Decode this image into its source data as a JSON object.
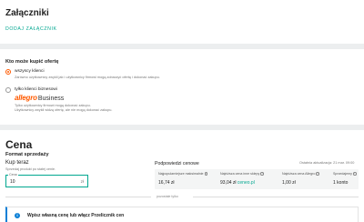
{
  "attachments": {
    "title": "Załączniki",
    "add_link": "DODAJ ZAŁĄCZNIK"
  },
  "buyers": {
    "title": "Kto może kupić ofertę",
    "options": [
      {
        "label": "wszyscy klienci",
        "desc": "Zarówno użytkownicy zwykli jak i użytkownicy firmowi mogą zobaczyć ofertę i dokonać zakupu.",
        "checked": true
      },
      {
        "label": "tylko klienci biznesowi",
        "desc_1": "Tylko użytkownicy firmowi mogą dokonać zakupu.",
        "desc_2": "Użytkownicy zwykli widzą ofertę, ale nie mogą dokonać zakupu.",
        "checked": false
      }
    ],
    "logo_word": "allegro",
    "logo_suffix": "Business"
  },
  "price": {
    "title": "Cena",
    "format_title": "Format sprzedaży",
    "buy_now": "Kup teraz",
    "buy_now_desc": "Sprzedaj produkt po stałej cenie.",
    "field_label": "Cena",
    "field_value": "10",
    "field_unit": "zł",
    "suggestions_title": "Podpowiedzi cenowe",
    "updated": "Ostatnia aktualizacja: 21 mar. 09:00",
    "columns": [
      {
        "header": "Najpopularniejsze maksimalnie",
        "value": "16,74 zł"
      },
      {
        "header": "Najniższa cena inne sklepy",
        "value": "93,04 zł",
        "value_link": "ceneo.pl"
      },
      {
        "header": "Najniższa cena Allegro",
        "value": "1,00 zł"
      },
      {
        "header": "Sprzedajemy",
        "value": "1 konto"
      }
    ],
    "or_label": "pozostałe tylko",
    "banner_text": "Wpisz własną cenę lub włącz Przelicznik cen",
    "accent": "#00a790",
    "brand": "#ff5a00",
    "info_color": "#0b7fd6"
  }
}
